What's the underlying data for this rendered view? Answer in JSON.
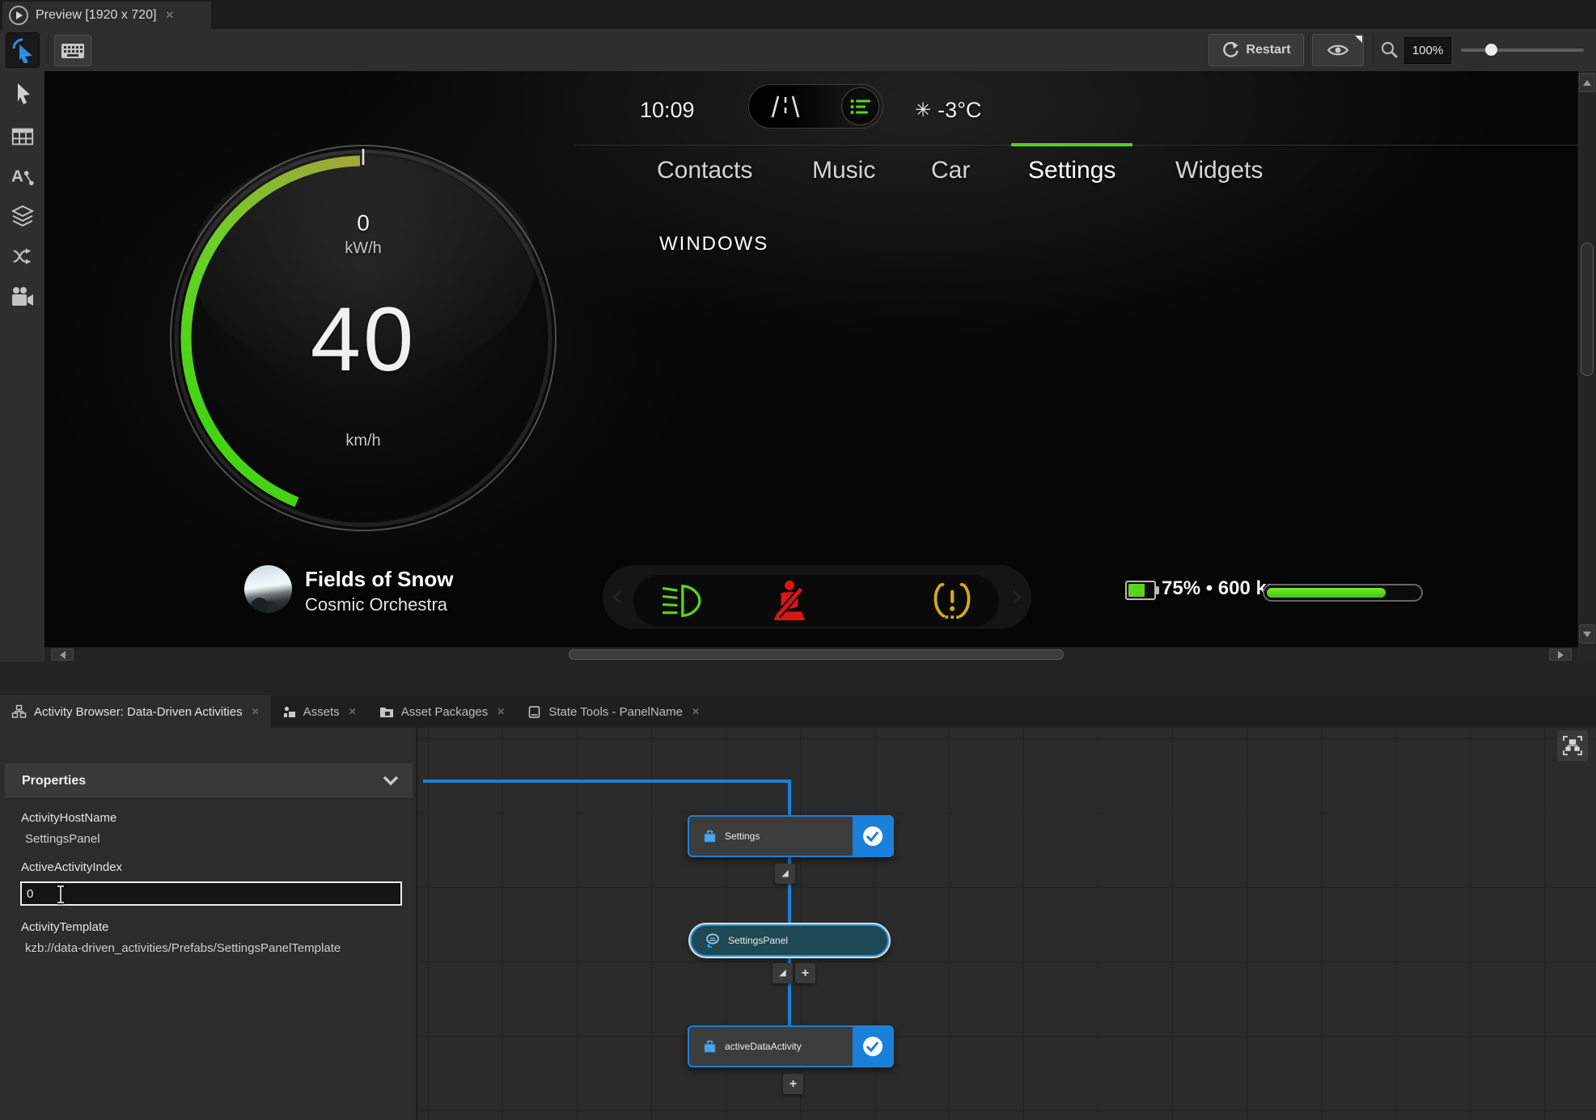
{
  "window": {
    "preview_tab_title": "Preview [1920 x 720]",
    "toolbar": {
      "restart_label": "Restart",
      "zoom_level": "100%"
    }
  },
  "hmi": {
    "status_bar": {
      "time": "10:09",
      "temperature": "-3°C"
    },
    "nav_tabs": [
      {
        "label": "Contacts",
        "active": false
      },
      {
        "label": "Music",
        "active": false
      },
      {
        "label": "Car",
        "active": false
      },
      {
        "label": "Settings",
        "active": true
      },
      {
        "label": "Widgets",
        "active": false
      }
    ],
    "section_title": "WINDOWS",
    "gauge": {
      "power_value": "0",
      "power_unit": "kW/h",
      "speed_value": "40",
      "speed_unit": "km/h"
    },
    "media": {
      "title": "Fields of Snow",
      "artist": "Cosmic Orchestra"
    },
    "indicators": [
      {
        "name": "headlight",
        "color": "#5bd41f"
      },
      {
        "name": "seatbelt",
        "color": "#d81616"
      },
      {
        "name": "tire-pressure",
        "color": "#d4a81c"
      }
    ],
    "battery": {
      "label": "75% • 600 km",
      "percent": 75
    }
  },
  "panel_tabs": [
    {
      "label": "Activity Browser: Data-Driven Activities",
      "active": true
    },
    {
      "label": "Assets",
      "active": false
    },
    {
      "label": "Asset Packages",
      "active": false
    },
    {
      "label": "State Tools - PanelName",
      "active": false
    }
  ],
  "properties": {
    "title": "Properties",
    "fields": [
      {
        "label": "ActivityHostName",
        "value": "SettingsPanel"
      },
      {
        "label": "ActiveActivityIndex",
        "value": "0"
      },
      {
        "label": "ActivityTemplate",
        "value": "kzb://data-driven_activities/Prefabs/SettingsPanelTemplate"
      }
    ]
  },
  "graph": {
    "nodes": [
      {
        "label": "Settings",
        "kind": "activity",
        "checked": true
      },
      {
        "label": "SettingsPanel",
        "kind": "activity-host",
        "checked": false
      },
      {
        "label": "activeDataActivity",
        "kind": "activity",
        "checked": true
      }
    ]
  },
  "colors": {
    "accent_blue": "#1b80d9",
    "hmi_green": "#5bd41f",
    "warning_red": "#d81616",
    "warning_amber": "#d4a81c"
  }
}
